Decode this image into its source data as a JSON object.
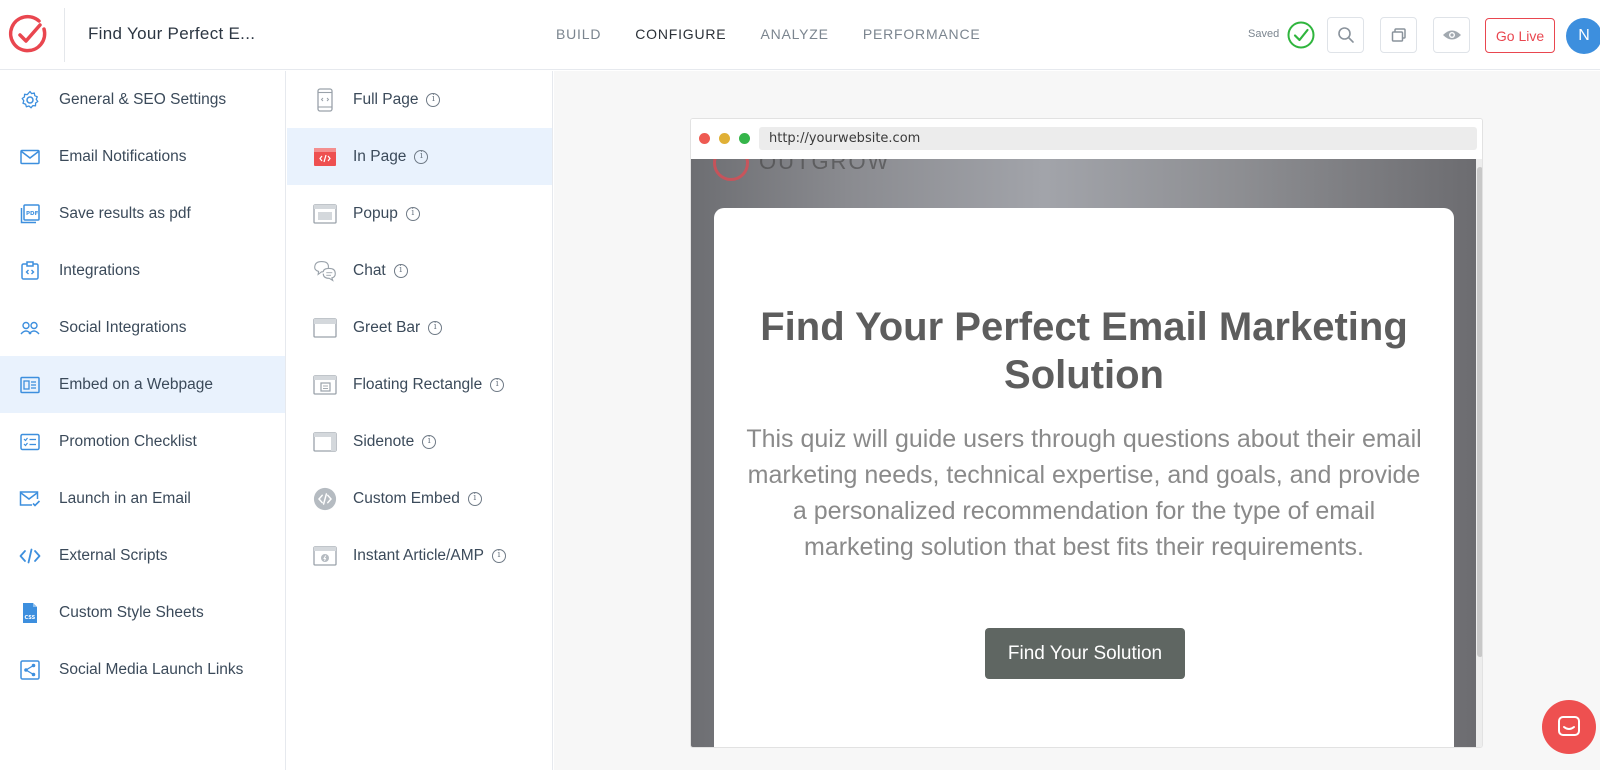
{
  "header": {
    "title": "Find Your Perfect E...",
    "nav": [
      {
        "label": "BUILD"
      },
      {
        "label": "CONFIGURE"
      },
      {
        "label": "ANALYZE"
      },
      {
        "label": "PERFORMANCE"
      }
    ],
    "active_nav": "CONFIGURE",
    "saved_label": "Saved",
    "go_live_label": "Go Live",
    "avatar_initial": "N",
    "accent_color": "#e9464f"
  },
  "sidebar": {
    "items": [
      {
        "label": "General & SEO Settings",
        "icon": "gear-icon"
      },
      {
        "label": "Email Notifications",
        "icon": "envelope-icon"
      },
      {
        "label": "Save results as pdf",
        "icon": "pdf-icon"
      },
      {
        "label": "Integrations",
        "icon": "integrations-icon"
      },
      {
        "label": "Social Integrations",
        "icon": "users-icon"
      },
      {
        "label": "Embed on a Webpage",
        "icon": "embed-icon",
        "active": true
      },
      {
        "label": "Promotion Checklist",
        "icon": "checklist-icon"
      },
      {
        "label": "Launch in an Email",
        "icon": "email-check-icon"
      },
      {
        "label": " External Scripts",
        "icon": "code-icon"
      },
      {
        "label": "Custom Style Sheets",
        "icon": "css-file-icon"
      },
      {
        "label": "Social Media Launch Links",
        "icon": "share-icon"
      }
    ]
  },
  "embed_types": {
    "items": [
      {
        "label": "Full Page",
        "icon": "mobile-page-icon"
      },
      {
        "label": "In Page",
        "icon": "in-page-code-icon",
        "active": true
      },
      {
        "label": "Popup",
        "icon": "popup-icon"
      },
      {
        "label": "Chat",
        "icon": "chat-icon"
      },
      {
        "label": "Greet Bar",
        "icon": "greet-bar-icon"
      },
      {
        "label": "Floating Rectangle",
        "icon": "floating-rectangle-icon"
      },
      {
        "label": "Sidenote",
        "icon": "sidenote-icon"
      },
      {
        "label": "Custom Embed",
        "icon": "custom-embed-icon"
      },
      {
        "label": "Instant Article/AMP",
        "icon": "amp-icon"
      }
    ],
    "info_glyph": "i"
  },
  "preview": {
    "url": "http://yourwebsite.com",
    "bg_logo_text": "OUTGROW",
    "quiz_title": "Find Your Perfect Email Marketing Solution",
    "quiz_description": "This quiz will guide users through questions about their email marketing needs, technical expertise, and goals, and provide a personalized recommendation for the type of email marketing solution that best fits their requirements.",
    "cta_label": "Find Your Solution",
    "cta_color": "#5f6662"
  }
}
